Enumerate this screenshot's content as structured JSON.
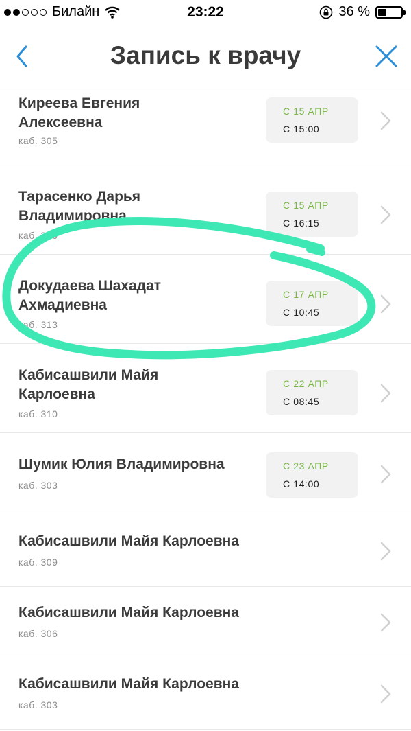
{
  "status_bar": {
    "carrier": "Билайн",
    "time": "23:22",
    "battery_text": "36 %",
    "battery_level": 0.36
  },
  "nav": {
    "title": "Запись к врачу",
    "back_icon": "chevron-left-icon",
    "close_icon": "close-icon"
  },
  "colors": {
    "accent_blue": "#2a8fd8",
    "slot_green": "#7ab648",
    "annotation": "#3ee8b4"
  },
  "doctors": [
    {
      "name": "Киреева Евгения Алексеевна",
      "room": "каб. 305",
      "slot_date": "С 15 АПР",
      "slot_time": "С 15:00"
    },
    {
      "name": "Тарасенко Дарья Владимировна",
      "room": "каб. 306",
      "slot_date": "С 15 АПР",
      "slot_time": "С 16:15"
    },
    {
      "name": "Докудаева Шахадат Ахмадиевна",
      "room": "каб. 313",
      "slot_date": "С 17 АПР",
      "slot_time": "С 10:45"
    },
    {
      "name": "Кабисашвили Майя Карлоевна",
      "room": "каб. 310",
      "slot_date": "С 22 АПР",
      "slot_time": "С 08:45"
    },
    {
      "name": "Шумик Юлия Владимировна",
      "room": "каб. 303",
      "slot_date": "С 23 АПР",
      "slot_time": "С 14:00"
    },
    {
      "name": "Кабисашвили Майя Карлоевна",
      "room": "каб. 309"
    },
    {
      "name": "Кабисашвили Майя Карлоевна",
      "room": "каб. 306"
    },
    {
      "name": "Кабисашвили Майя Карлоевна",
      "room": "каб. 303"
    }
  ]
}
